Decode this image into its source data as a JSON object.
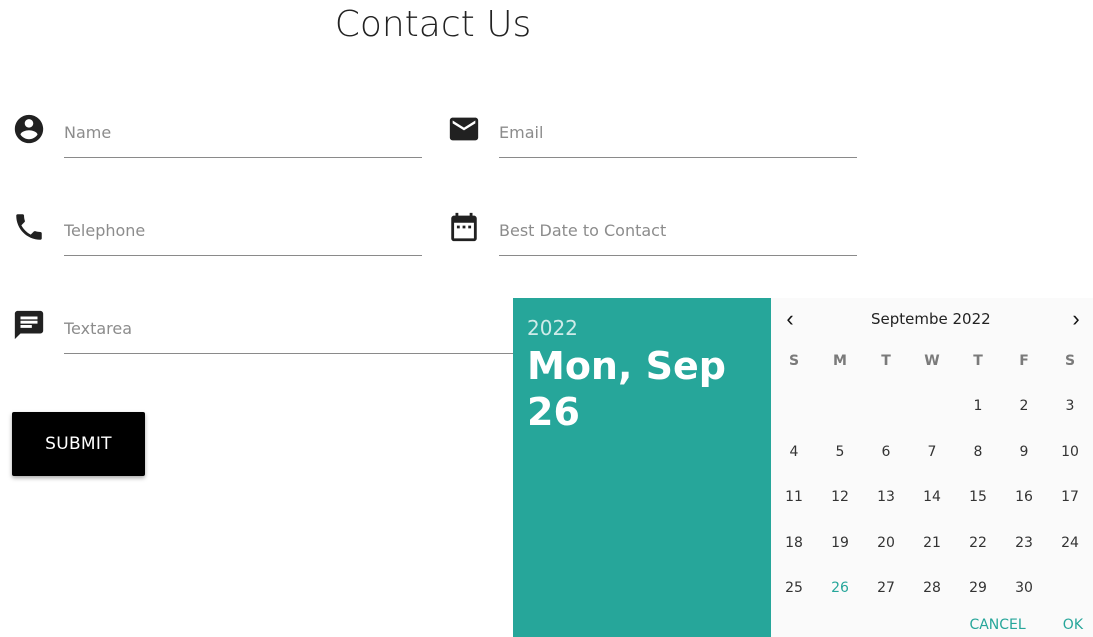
{
  "page": {
    "title": "Contact Us"
  },
  "form": {
    "name": {
      "placeholder": "Name",
      "value": ""
    },
    "email": {
      "placeholder": "Email",
      "value": ""
    },
    "telephone": {
      "placeholder": "Telephone",
      "value": ""
    },
    "date": {
      "placeholder": "Best Date to Contact",
      "value": ""
    },
    "message": {
      "placeholder": "Textarea",
      "value": ""
    },
    "submit_label": "SUBMIT"
  },
  "datepicker": {
    "year": "2022",
    "selected_label": "Mon, Sep 26",
    "month_label": "Septembe 2022",
    "weekdays": [
      "S",
      "M",
      "T",
      "W",
      "T",
      "F",
      "S"
    ],
    "weeks": [
      [
        "",
        "",
        "",
        "",
        "1",
        "2",
        "3"
      ],
      [
        "4",
        "5",
        "6",
        "7",
        "8",
        "9",
        "10"
      ],
      [
        "11",
        "12",
        "13",
        "14",
        "15",
        "16",
        "17"
      ],
      [
        "18",
        "19",
        "20",
        "21",
        "22",
        "23",
        "24"
      ],
      [
        "25",
        "26",
        "27",
        "28",
        "29",
        "30",
        ""
      ]
    ],
    "selected_day": "26",
    "cancel_label": "CANCEL",
    "ok_label": "OK",
    "accent_color": "#26a69a"
  },
  "icons": {
    "name": "account-circle-icon",
    "email": "mail-icon",
    "telephone": "phone-icon",
    "date": "calendar-icon",
    "message": "message-icon"
  }
}
